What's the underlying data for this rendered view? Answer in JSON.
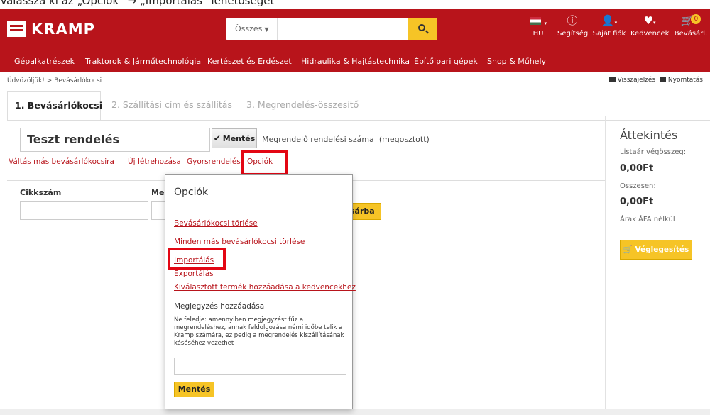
{
  "instruction": "Válassza ki az „Opciók” → „Importálás” lehetőséget",
  "header": {
    "brand": "KRAMP",
    "search": {
      "scope": "Összes",
      "placeholder": ""
    },
    "nav": [
      {
        "label": "HU",
        "icon": "flag-icon"
      },
      {
        "label": "Segítség",
        "icon": "info-icon"
      },
      {
        "label": "Saját fiók",
        "icon": "user-icon"
      },
      {
        "label": "Kedvencek",
        "icon": "heart-icon"
      },
      {
        "label": "Bevásárl.",
        "icon": "cart-icon",
        "badge": "0"
      }
    ]
  },
  "menu": [
    "Gépalkatrészek",
    "Traktorok & Járműtechnológia",
    "Kertészet és Erdészet",
    "Hidraulika & Hajtástechnika",
    "Építőipari gépek",
    "Shop & Műhely"
  ],
  "breadcrumb": "Üdvözöljük! > Bevásárlókocsi",
  "utility": {
    "feedback": "Visszajelzés",
    "print": "Nyomtatás"
  },
  "tabs": [
    "1. Bevásárlókocsi",
    "2. Szállítási cím és szállítás",
    "3. Megrendelés-összesítő"
  ],
  "order": {
    "name": "Teszt rendelés",
    "save_label": "Mentés",
    "order_number_label": "Megrendelő rendelési száma",
    "shared_label": "(megosztott)"
  },
  "actions": [
    "Váltás más bevásárlókocsira",
    "Új létrehozása",
    "Gyorsrendelés",
    "Opciók"
  ],
  "grid": {
    "col_article": "Cikkszám",
    "col_qty_partial": "Me",
    "add_to_cart_partial": "sárba"
  },
  "summary": {
    "title": "Áttekintés",
    "list_total_label": "Listaár végösszeg:",
    "list_total_value": "0,00Ft",
    "total_label": "Összesen:",
    "total_value": "0,00Ft",
    "vat_note": "Árak ÁFA nélkül",
    "finalize_label": "Véglegesítés"
  },
  "popup": {
    "title": "Opciók",
    "links": [
      "Bevásárlókocsi törlése",
      "Minden más bevásárlókocsi törlése",
      "Importálás",
      "Exportálás",
      "Kiválasztott termék hozzáadása a kedvencekhez"
    ],
    "note_heading": "Megjegyzés hozzáadása",
    "note_text": "Ne feledje: amennyiben megjegyzést fűz a megrendeléshez, annak feldolgozása némi időbe telik a Kramp számára, ez pedig a megrendelés kiszállításának késéséhez vezethet",
    "save_label": "Mentés"
  },
  "colors": {
    "brand_red": "#b8141b",
    "accent_yellow": "#f6c426",
    "highlight_red": "#e30613"
  }
}
